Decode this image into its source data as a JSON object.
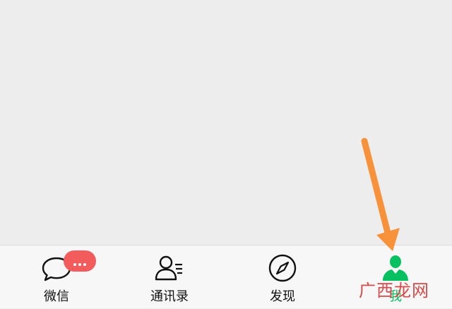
{
  "tabbar": {
    "tabs": [
      {
        "label": "微信",
        "icon": "chat-bubble-icon"
      },
      {
        "label": "通讯录",
        "icon": "contacts-icon"
      },
      {
        "label": "发现",
        "icon": "compass-icon"
      },
      {
        "label": "我",
        "icon": "person-icon",
        "active": true
      }
    ],
    "badge": {
      "text": "···"
    }
  },
  "annotation": {
    "icon": "arrow-icon",
    "color": "#f7923a"
  },
  "watermark": {
    "text": "广西龙网"
  },
  "colors": {
    "active": "#07c160",
    "badge": "#f25c5c",
    "background": "#ededed",
    "tabbar": "#f7f7f7"
  }
}
